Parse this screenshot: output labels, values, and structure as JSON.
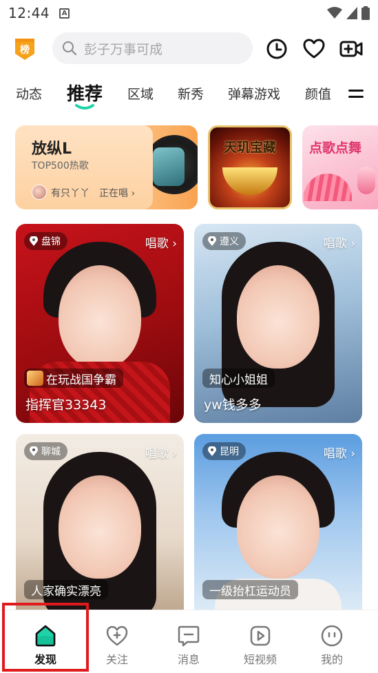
{
  "status_bar": {
    "time": "12:44",
    "app_badge": "A"
  },
  "header": {
    "rank_badge": "榜",
    "search": {
      "placeholder": "彭子万事可成"
    }
  },
  "tabs": [
    {
      "label": "动态"
    },
    {
      "label": "推荐",
      "active": true
    },
    {
      "label": "区域"
    },
    {
      "label": "新秀"
    },
    {
      "label": "弹幕游戏"
    },
    {
      "label": "颜值"
    }
  ],
  "banners": {
    "music": {
      "title": "放纵L",
      "subtitle": "TOP500热歌",
      "user": "有只丫丫",
      "status": "正在唱 ›"
    },
    "treasure": {
      "title": "天玑宝藏"
    },
    "song": {
      "title": "点歌点舞"
    }
  },
  "cards": [
    {
      "location": "盘锦",
      "tag": "唱歌 ›",
      "activity": "在玩战国争霸",
      "name": "指挥官33343"
    },
    {
      "location": "遵义",
      "tag": "唱歌 ›",
      "activity": "知心小姐姐",
      "name": "yw钱多多"
    },
    {
      "location": "聊城",
      "tag": "唱歌 ›",
      "activity": "人家确实漂亮",
      "name": ""
    },
    {
      "location": "昆明",
      "tag": "唱歌 ›",
      "activity": "一级抬杠运动员",
      "name": ""
    }
  ],
  "bottom_nav": [
    {
      "label": "发现",
      "icon": "home-icon",
      "active": true
    },
    {
      "label": "关注",
      "icon": "heart-plus-icon"
    },
    {
      "label": "消息",
      "icon": "message-icon"
    },
    {
      "label": "短视频",
      "icon": "video-play-icon"
    },
    {
      "label": "我的",
      "icon": "profile-face-icon"
    }
  ],
  "colors": {
    "accent": "#1fd2a8",
    "highlight": "#e0191c",
    "rank_badge": "#f7a21b"
  }
}
